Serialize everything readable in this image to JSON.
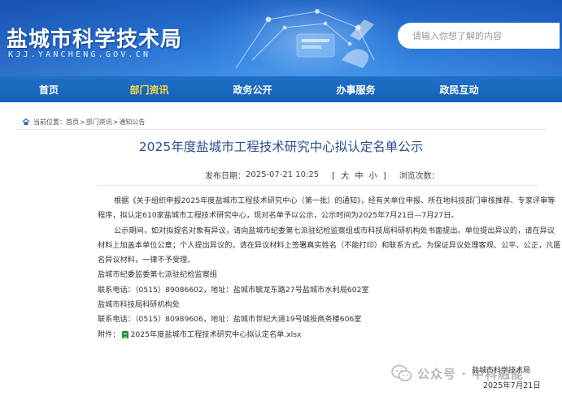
{
  "header": {
    "site_title": "盐城市科学技术局",
    "site_domain": "KJJ.YANCHENG.GOV.CN",
    "search_placeholder": "请输入你想了解的内容"
  },
  "nav": {
    "items": [
      {
        "label": "首页"
      },
      {
        "label": "部门资讯"
      },
      {
        "label": "政务公开"
      },
      {
        "label": "办事服务"
      },
      {
        "label": "政民互动"
      }
    ],
    "active_index": 1
  },
  "breadcrumb": {
    "prefix": "当前位置：",
    "items": [
      "首页",
      "部门资讯",
      "通知公告"
    ]
  },
  "article": {
    "title": "2025年度盐城市工程技术研究中心拟认定名单公示",
    "publish_label": "发布日期：",
    "publish_time": "2025-07-21 10:25",
    "size_open": "[",
    "size_large": "大",
    "size_medium": "中",
    "size_small": "小",
    "size_close": "]",
    "views_label": "浏览次数：",
    "paragraphs": {
      "p1": "根据《关于组织申报2025年度盐城市工程技术研究中心（第一批）的通知》，经有关单位申报、所在地科技部门审核推荐、专家评审等程序，拟认定610家盐城市工程技术研究中心，现对名单予以公示，公示时间为2025年7月21日—7月27日。",
      "p2": "公示期间，如对拟提名对象有异议，请向盐城市纪委第七派驻纪检监察组或市科技局科研机构处书面提出。单位提出异议的，请在异议材料上加盖本单位公章；个人提出异议的，请在异议材料上签署真实姓名（不能打印）和联系方式。为保证异议处理客观、公平、公正，凡匿名异议材料，一律不予受理。",
      "c1_name": "盐城市纪委监委第七派驻纪检监察组",
      "c1_info": "联系电话：（0515）89086602，地址：盐城市毓龙东路27号盐城市水利局602室",
      "c2_name": "盐城市科技局科研机构处",
      "c2_info": "联系电话：（0515）80989606，地址：盐城市世纪大道19号城投商务楼606室",
      "attach_label": "附件：",
      "attach_file": "2025年度盐城市工程技术研究中心拟认定名单.xlsx"
    },
    "signature": "盐城市科学技术局",
    "date": "2025年7月21日"
  },
  "watermark": {
    "text": "公众号 · 中科融能"
  },
  "colors": {
    "banner_blue": "#1d5fc0",
    "nav_blue": "#1260b8",
    "nav_active": "#ffd54a",
    "title_blue": "#2b4f8d"
  }
}
